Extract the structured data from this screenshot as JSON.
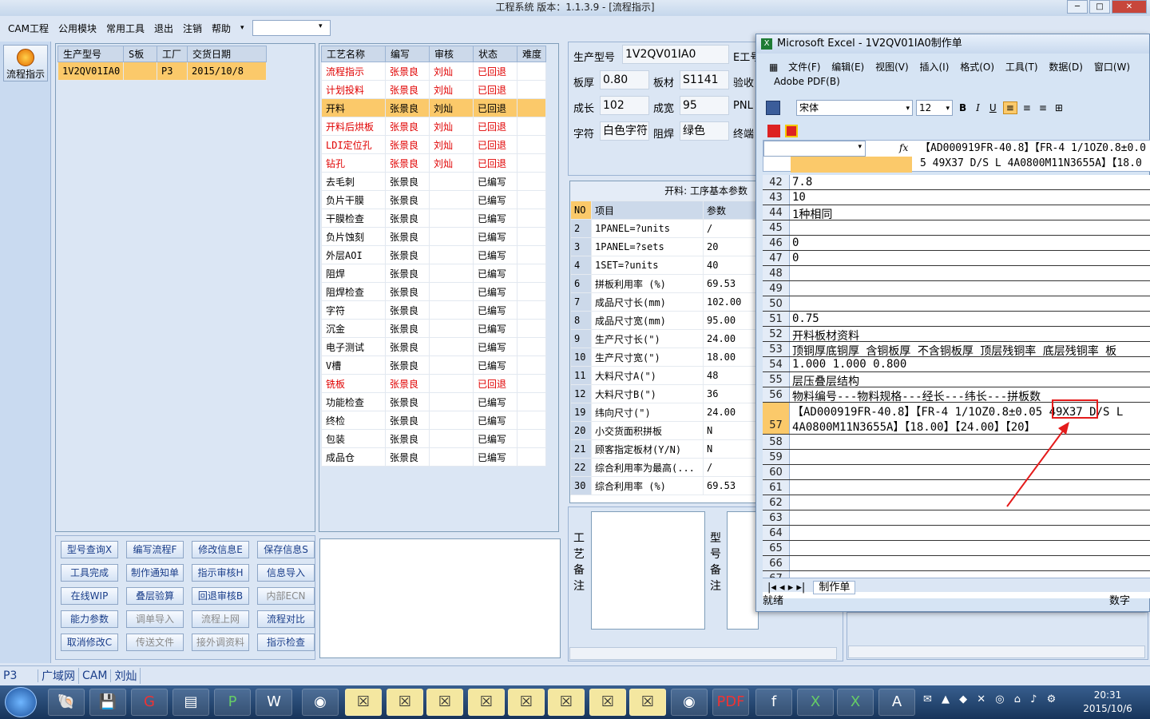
{
  "window": {
    "title": "工程系统   版本：1.1.3.9 - [流程指示]"
  },
  "menu": [
    "CAM工程",
    "公用模块",
    "常用工具",
    "退出",
    "注销",
    "帮助"
  ],
  "nav": {
    "flow_label": "流程指示"
  },
  "order_table": {
    "headers": [
      "生产型号",
      "S板",
      "工厂",
      "交货日期"
    ],
    "rows": [
      [
        "1V2QV01IA0",
        "",
        "P3",
        "2015/10/8"
      ]
    ]
  },
  "process_table": {
    "headers": [
      "工艺名称",
      "编写",
      "审核",
      "状态",
      "难度"
    ],
    "rows": [
      {
        "name": "流程指示",
        "writer": "张景良",
        "reviewer": "刘灿",
        "status": "已回退",
        "flag": "red"
      },
      {
        "name": "计划投料",
        "writer": "张景良",
        "reviewer": "刘灿",
        "status": "已回退",
        "flag": "red"
      },
      {
        "name": "开料",
        "writer": "张景良",
        "reviewer": "刘灿",
        "status": "已回退",
        "flag": "sel"
      },
      {
        "name": "开料后烘板",
        "writer": "张景良",
        "reviewer": "刘灿",
        "status": "已回退",
        "flag": "red"
      },
      {
        "name": "LDI定位孔",
        "writer": "张景良",
        "reviewer": "刘灿",
        "status": "已回退",
        "flag": "red"
      },
      {
        "name": "钻孔",
        "writer": "张景良",
        "reviewer": "刘灿",
        "status": "已回退",
        "flag": "red"
      },
      {
        "name": "去毛刺",
        "writer": "张景良",
        "reviewer": "",
        "status": "已编写",
        "flag": ""
      },
      {
        "name": "负片干膜",
        "writer": "张景良",
        "reviewer": "",
        "status": "已编写",
        "flag": ""
      },
      {
        "name": "干膜检查",
        "writer": "张景良",
        "reviewer": "",
        "status": "已编写",
        "flag": ""
      },
      {
        "name": "负片蚀刻",
        "writer": "张景良",
        "reviewer": "",
        "status": "已编写",
        "flag": ""
      },
      {
        "name": "外层AOI",
        "writer": "张景良",
        "reviewer": "",
        "status": "已编写",
        "flag": ""
      },
      {
        "name": "阻焊",
        "writer": "张景良",
        "reviewer": "",
        "status": "已编写",
        "flag": ""
      },
      {
        "name": "阻焊检查",
        "writer": "张景良",
        "reviewer": "",
        "status": "已编写",
        "flag": ""
      },
      {
        "name": "字符",
        "writer": "张景良",
        "reviewer": "",
        "status": "已编写",
        "flag": ""
      },
      {
        "name": "沉金",
        "writer": "张景良",
        "reviewer": "",
        "status": "已编写",
        "flag": ""
      },
      {
        "name": "电子测试",
        "writer": "张景良",
        "reviewer": "",
        "status": "已编写",
        "flag": ""
      },
      {
        "name": "V槽",
        "writer": "张景良",
        "reviewer": "",
        "status": "已编写",
        "flag": ""
      },
      {
        "name": "铣板",
        "writer": "张景良",
        "reviewer": "",
        "status": "已回退",
        "flag": "red"
      },
      {
        "name": "功能检查",
        "writer": "张景良",
        "reviewer": "",
        "status": "已编写",
        "flag": ""
      },
      {
        "name": "终检",
        "writer": "张景良",
        "reviewer": "",
        "status": "已编写",
        "flag": ""
      },
      {
        "name": "包装",
        "writer": "张景良",
        "reviewer": "",
        "status": "已编写",
        "flag": ""
      },
      {
        "name": "成品仓",
        "writer": "张景良",
        "reviewer": "",
        "status": "已编写",
        "flag": ""
      }
    ]
  },
  "buttons": [
    [
      "型号查询X",
      "编写流程F",
      "修改信息E",
      "保存信息S"
    ],
    [
      "工具完成",
      "制作通知单",
      "指示审核H",
      "信息导入"
    ],
    [
      "在线WIP",
      "叠层验算",
      "回退审核B",
      "内部ECN"
    ],
    [
      "能力参数",
      "调单导入",
      "流程上网",
      "流程对比"
    ],
    [
      "取消修改C",
      "传送文件",
      "接外调资料",
      "指示检查"
    ]
  ],
  "disabled_buttons": [
    "内部ECN",
    "调单导入",
    "流程上网",
    "传送文件",
    "接外调资料"
  ],
  "info": {
    "model_label": "生产型号",
    "model": "1V2QV01IA0",
    "e_label": "E工号",
    "thick_label": "板厚",
    "thick": "0.80",
    "mat_label": "板材",
    "mat": "S1141",
    "check_label": "验收",
    "len_label": "成长",
    "len": "102",
    "wid_label": "成宽",
    "wid": "95",
    "pnl_label": "PNL",
    "char_label": "字符",
    "char": "白色字符",
    "mask_label": "阻焊",
    "mask": "绿色",
    "final_label": "终端"
  },
  "params": {
    "title": "开料: 工序基本参数",
    "headers": [
      "NO",
      "项目",
      "参数"
    ],
    "rows": [
      [
        "2",
        "1PANEL=?units",
        "/"
      ],
      [
        "3",
        "1PANEL=?sets",
        "20"
      ],
      [
        "4",
        "1SET=?units",
        "40"
      ],
      [
        "6",
        "拼板利用率 (%)",
        "69.53"
      ],
      [
        "7",
        "成品尺寸长(mm)",
        "102.00"
      ],
      [
        "8",
        "成品尺寸宽(mm)",
        "95.00"
      ],
      [
        "9",
        "生产尺寸长(\")",
        "24.00"
      ],
      [
        "10",
        "生产尺寸宽(\")",
        "18.00"
      ],
      [
        "11",
        "大料尺寸A(\")",
        "48"
      ],
      [
        "12",
        "大料尺寸B(\")",
        "36"
      ],
      [
        "19",
        "纬向尺寸(\")",
        "24.00"
      ],
      [
        "20",
        "小交货面积拼板",
        "N"
      ],
      [
        "21",
        "顾客指定板材(Y/N)",
        "N"
      ],
      [
        "22",
        "综合利用率为最高(...",
        "/"
      ],
      [
        "30",
        "综合利用率 (%)",
        "69.53"
      ]
    ]
  },
  "remarks": {
    "process": "工艺备注",
    "model": "型号备注"
  },
  "status": [
    "P3",
    "广域网",
    "CAM",
    "刘灿"
  ],
  "excel": {
    "title": "Microsoft Excel - 1V2QV01IA0制作单",
    "menu": [
      "文件(F)",
      "编辑(E)",
      "视图(V)",
      "插入(I)",
      "格式(O)",
      "工具(T)",
      "数据(D)",
      "窗口(W)"
    ],
    "menu2": "Adobe PDF(B)",
    "font": "宋体",
    "size": "12",
    "formula": "【AD000919FR-40.8】【FR-4 1/1OZ0.8±0.05 49X37 D/S L 4A0800M11N3655A】【18.00】【24.00】【20】",
    "rows": [
      {
        "n": "42",
        "v": "7.8"
      },
      {
        "n": "43",
        "v": "10"
      },
      {
        "n": "44",
        "v": "1种相同"
      },
      {
        "n": "45",
        "v": ""
      },
      {
        "n": "46",
        "v": "0"
      },
      {
        "n": "47",
        "v": "0"
      },
      {
        "n": "48",
        "v": ""
      },
      {
        "n": "49",
        "v": ""
      },
      {
        "n": "50",
        "v": ""
      },
      {
        "n": "51",
        "v": "0.75"
      },
      {
        "n": "52",
        "v": "开料板材资料"
      },
      {
        "n": "53",
        "v": "顶铜厚底铜厚 含铜板厚 不含铜板厚 顶层残铜率 底层残铜率 板"
      },
      {
        "n": "54",
        "v": "1.000  1.000  0.800"
      },
      {
        "n": "55",
        "v": "层压叠层结构"
      },
      {
        "n": "56",
        "v": "物料编号---物料规格---经长---纬长---拼板数"
      },
      {
        "n": "57",
        "v": "【AD000919FR-40.8】【FR-4 1/1OZ0.8±0.05 49X37  D/S L",
        "v2": "4A0800M11N3655A】【18.00】【24.00】【20】"
      },
      {
        "n": "58",
        "v": ""
      },
      {
        "n": "59",
        "v": ""
      },
      {
        "n": "60",
        "v": ""
      },
      {
        "n": "61",
        "v": ""
      },
      {
        "n": "62",
        "v": ""
      },
      {
        "n": "63",
        "v": ""
      },
      {
        "n": "64",
        "v": ""
      },
      {
        "n": "65",
        "v": ""
      },
      {
        "n": "66",
        "v": ""
      },
      {
        "n": "67",
        "v": ""
      }
    ],
    "sheet_tab": "制作单",
    "status_left": "就绪",
    "status_right": "数字"
  },
  "tray": {
    "time": "20:31",
    "date": "2015/10/6"
  }
}
